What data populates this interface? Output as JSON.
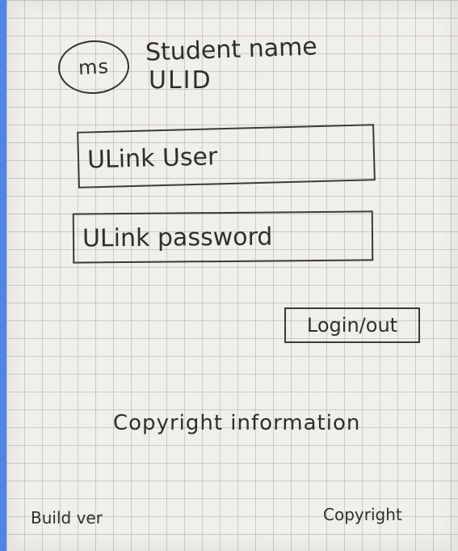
{
  "header": {
    "avatar_initials": "ms",
    "student_name": "Student name",
    "student_id": "ULID"
  },
  "login": {
    "username_label": "ULink User",
    "password_label": "ULink password",
    "button_label": "Login/out"
  },
  "content": {
    "copyright_information": "Copyright information"
  },
  "footer": {
    "build_ver": "Build ver",
    "copyright": "Copyright"
  }
}
